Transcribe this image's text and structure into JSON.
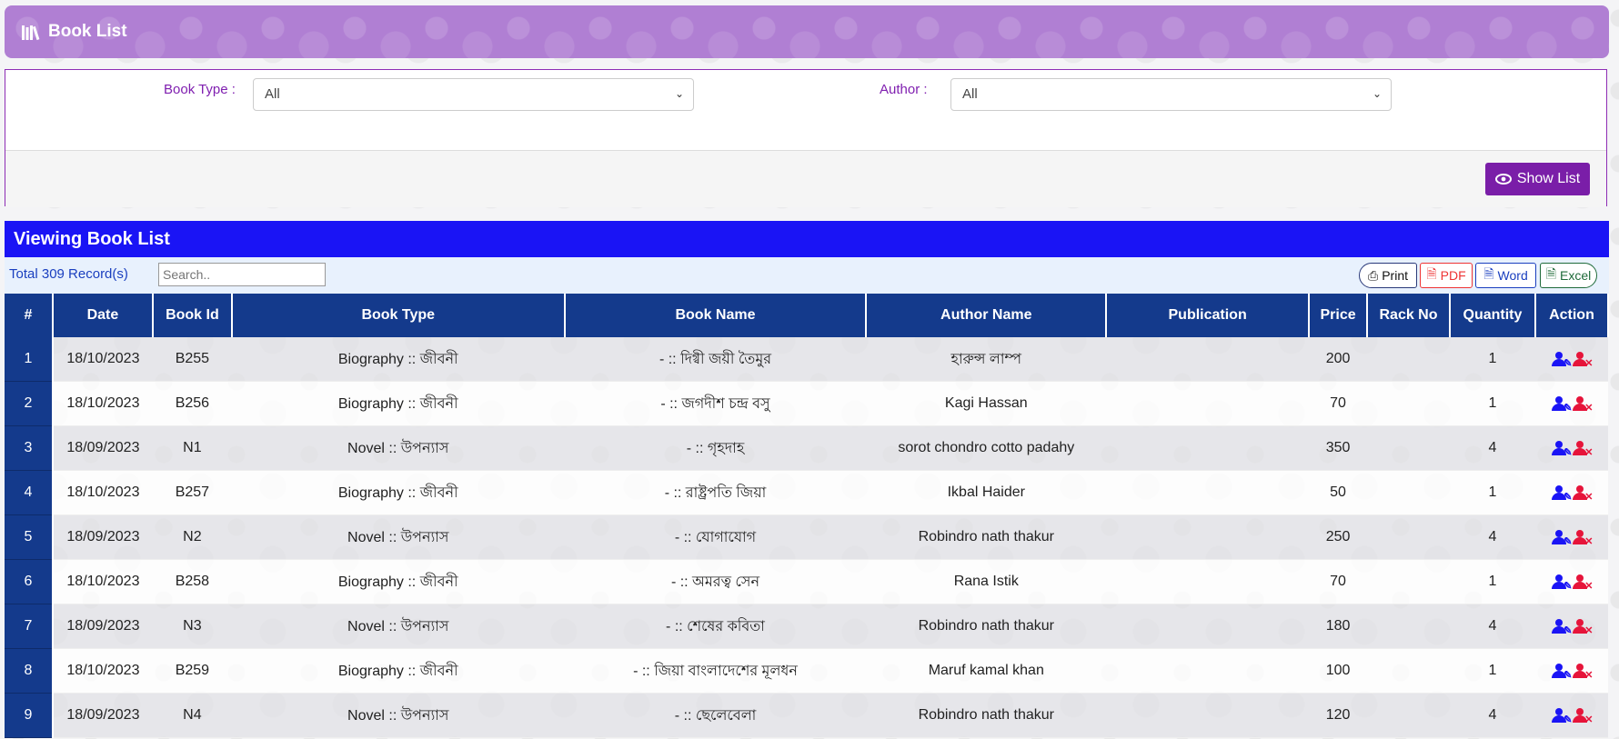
{
  "header": {
    "title": "Book List",
    "icon": "library-icon"
  },
  "filters": {
    "book_type_label": "Book Type :",
    "book_type_value": "All",
    "author_label": "Author :",
    "author_value": "All",
    "show_button": "Show List"
  },
  "viewing": {
    "title": "Viewing Book List",
    "total": "Total 309 Record(s)",
    "search_placeholder": "Search.."
  },
  "export": {
    "print": "Print",
    "pdf": "PDF",
    "word": "Word",
    "excel": "Excel"
  },
  "colors": {
    "header": "#b07fd3",
    "accent_purple": "#7a1ea8",
    "view_bar": "#1a14f5",
    "table_head": "#143a8c",
    "delete": "#e6143a"
  },
  "table": {
    "columns": [
      "#",
      "Date",
      "Book Id",
      "Book Type",
      "Book Name",
      "Author Name",
      "Publication",
      "Price",
      "Rack No",
      "Quantity",
      "Action"
    ],
    "rows": [
      {
        "num": "1",
        "date": "18/10/2023",
        "id": "B255",
        "type": "Biography :: জীবনী",
        "name": "- :: দিগ্বী জয়ী তৈমুর",
        "author": "হারুন্স লাম্প",
        "publication": "",
        "price": "200",
        "rack": "",
        "qty": "1"
      },
      {
        "num": "2",
        "date": "18/10/2023",
        "id": "B256",
        "type": "Biography :: জীবনী",
        "name": "- :: জগদীশ চন্দ্র বসু",
        "author": "Kagi Hassan",
        "publication": "",
        "price": "70",
        "rack": "",
        "qty": "1"
      },
      {
        "num": "3",
        "date": "18/09/2023",
        "id": "N1",
        "type": "Novel :: উপন্যাস",
        "name": "- :: গৃহদাহ",
        "author": "sorot chondro cotto padahy",
        "publication": "",
        "price": "350",
        "rack": "",
        "qty": "4"
      },
      {
        "num": "4",
        "date": "18/10/2023",
        "id": "B257",
        "type": "Biography :: জীবনী",
        "name": "- :: রাষ্ট্রপতি জিয়া",
        "author": "Ikbal Haider",
        "publication": "",
        "price": "50",
        "rack": "",
        "qty": "1"
      },
      {
        "num": "5",
        "date": "18/09/2023",
        "id": "N2",
        "type": "Novel :: উপন্যাস",
        "name": "- :: যোগাযোগ",
        "author": "Robindro nath thakur",
        "publication": "",
        "price": "250",
        "rack": "",
        "qty": "4"
      },
      {
        "num": "6",
        "date": "18/10/2023",
        "id": "B258",
        "type": "Biography :: জীবনী",
        "name": "- :: অমরত্ব সেন",
        "author": "Rana Istik",
        "publication": "",
        "price": "70",
        "rack": "",
        "qty": "1"
      },
      {
        "num": "7",
        "date": "18/09/2023",
        "id": "N3",
        "type": "Novel :: উপন্যাস",
        "name": "- :: শেষের কবিতা",
        "author": "Robindro nath thakur",
        "publication": "",
        "price": "180",
        "rack": "",
        "qty": "4"
      },
      {
        "num": "8",
        "date": "18/10/2023",
        "id": "B259",
        "type": "Biography :: জীবনী",
        "name": "- :: জিয়া বাংলাদেশের মূলধন",
        "author": "Maruf kamal khan",
        "publication": "",
        "price": "100",
        "rack": "",
        "qty": "1"
      },
      {
        "num": "9",
        "date": "18/09/2023",
        "id": "N4",
        "type": "Novel :: উপন্যাস",
        "name": "- :: ছেলেবেলা",
        "author": "Robindro nath thakur",
        "publication": "",
        "price": "120",
        "rack": "",
        "qty": "4"
      }
    ]
  }
}
